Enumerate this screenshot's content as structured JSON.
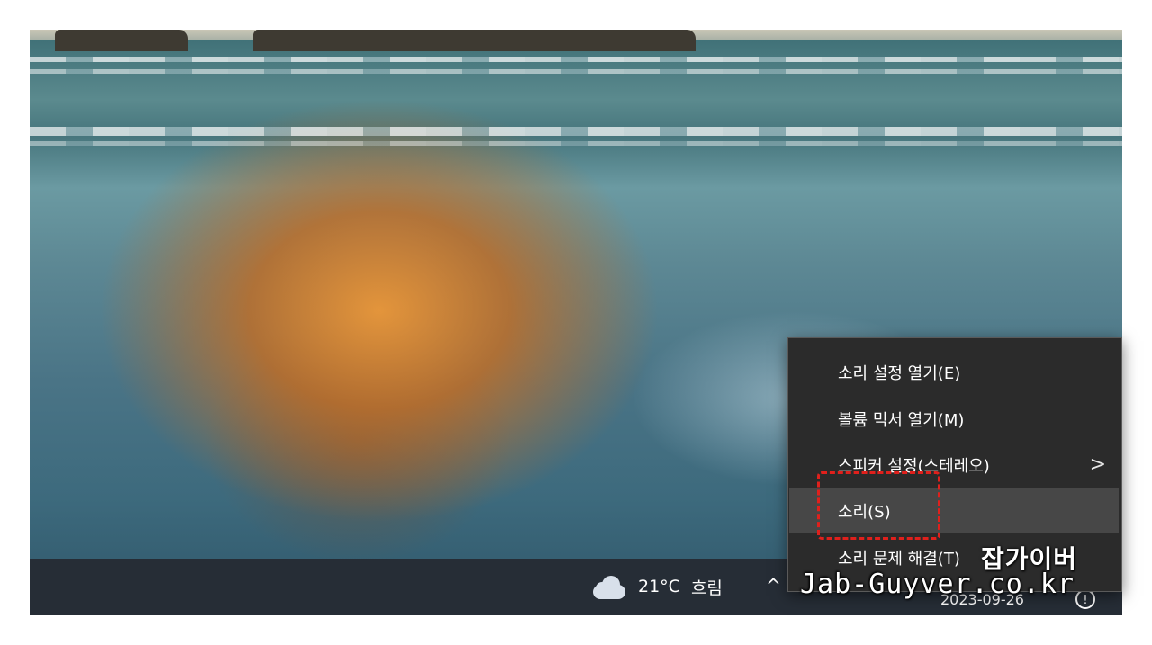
{
  "taskbar": {
    "weather": {
      "icon": "cloud-icon",
      "temperature": "21°C",
      "condition": "흐림"
    },
    "tray_chevron": "^",
    "date": "2023-09-26",
    "notification_icon": "notification-icon"
  },
  "context_menu": {
    "items": [
      {
        "label": "소리 설정 열기(E)"
      },
      {
        "label": "볼륨 믹서 열기(M)"
      },
      {
        "label": "스피커 설정(스테레오)",
        "submenu": true,
        "arrow": ">"
      },
      {
        "label": "소리(S)",
        "highlighted": true
      },
      {
        "label": "소리 문제 해결(T)"
      }
    ]
  },
  "annotation": {
    "highlight_color": "#e0201c",
    "target": "소리(S)"
  },
  "watermark": {
    "korean": "잡가이버",
    "domain": "Jab-Guyver.co.kr"
  }
}
